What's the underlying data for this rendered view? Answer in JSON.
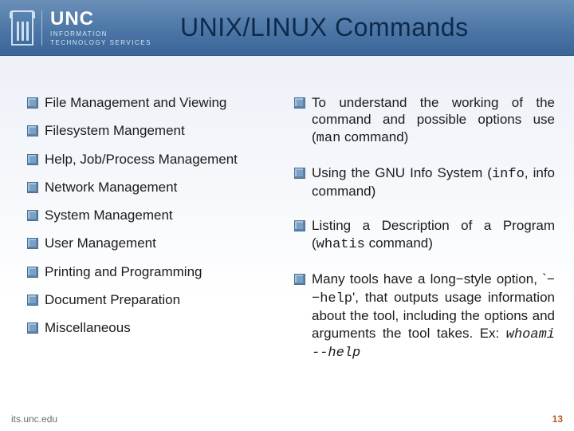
{
  "brand": {
    "name": "UNC",
    "subtitle1": "INFORMATION",
    "subtitle2": "TECHNOLOGY SERVICES"
  },
  "title": "UNIX/LINUX Commands",
  "left_items": [
    "File Management and Viewing",
    "Filesystem Mangement",
    "Help, Job/Process Management",
    "Network Management",
    "System Management",
    "User Management",
    "Printing and Programming",
    "Document Preparation",
    "Miscellaneous"
  ],
  "right_items": {
    "i0": {
      "pre": "To understand the working of the command and possible options use (",
      "code": "man",
      "post": " command)"
    },
    "i1": {
      "pre": "  Using the GNU Info System (",
      "code": "info",
      "post": ", info command)"
    },
    "i2": {
      "pre": "Listing a Description of a Program (",
      "code": "whatis",
      "post": " command)"
    },
    "i3": {
      "pre": "Many tools have a long−style option, `",
      "code1": "−−help",
      "mid": "', that outputs usage information about the tool, including the options and arguments the tool takes. Ex: ",
      "code2": "whoami --help"
    }
  },
  "footer": {
    "site": "its.unc.edu",
    "page": "13"
  }
}
